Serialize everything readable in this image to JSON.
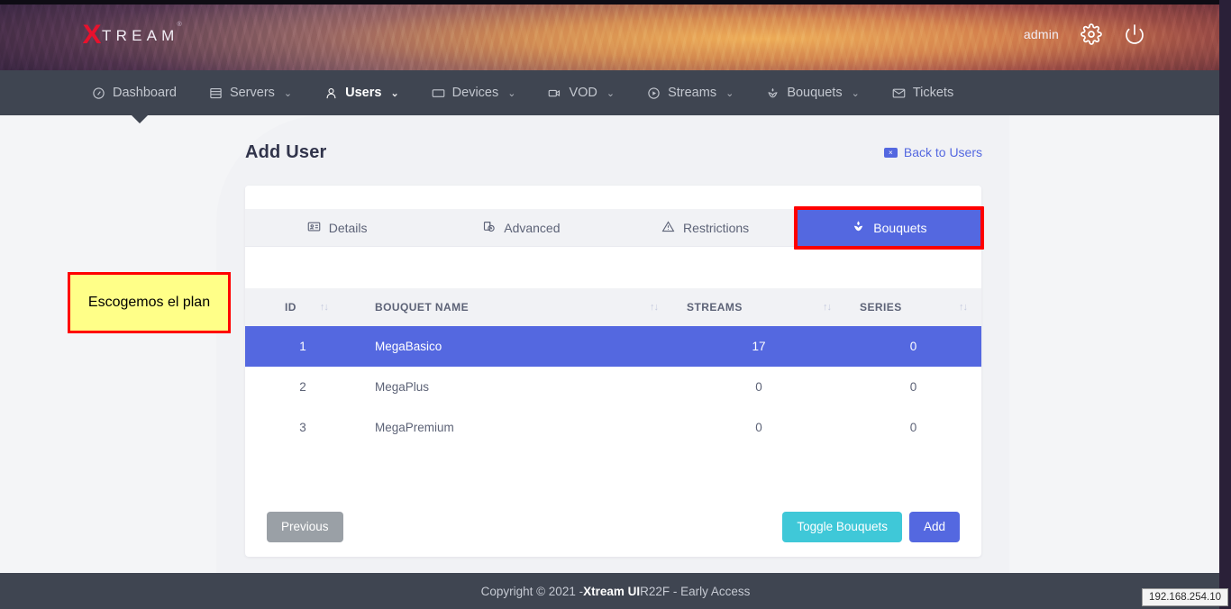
{
  "topbar": {
    "brand_x": "X",
    "brand_rest": "TREAM",
    "brand_tm": "®",
    "admin_label": "admin",
    "settings_icon": "gear-icon",
    "power_icon": "power-icon"
  },
  "nav": {
    "items": [
      {
        "label": "Dashboard",
        "icon": "dashboard-icon",
        "caret": "",
        "active": false
      },
      {
        "label": "Servers",
        "icon": "server-icon",
        "caret": "⌄",
        "active": false
      },
      {
        "label": "Users",
        "icon": "user-icon",
        "caret": "⌄",
        "active": true
      },
      {
        "label": "Devices",
        "icon": "device-icon",
        "caret": "⌄",
        "active": false
      },
      {
        "label": "VOD",
        "icon": "video-icon",
        "caret": "⌄",
        "active": false
      },
      {
        "label": "Streams",
        "icon": "play-icon",
        "caret": "⌄",
        "active": false
      },
      {
        "label": "Bouquets",
        "icon": "bouquet-icon",
        "caret": "⌄",
        "active": false
      },
      {
        "label": "Tickets",
        "icon": "envelope-icon",
        "caret": "",
        "active": false
      }
    ]
  },
  "page": {
    "title": "Add User",
    "back_link": "Back to Users",
    "back_badge": "×"
  },
  "tabs": [
    {
      "label": "Details",
      "icon": "id-card-icon",
      "active": false
    },
    {
      "label": "Advanced",
      "icon": "clock-copy-icon",
      "active": false
    },
    {
      "label": "Restrictions",
      "icon": "warning-icon",
      "active": false
    },
    {
      "label": "Bouquets",
      "icon": "bouquet-icon",
      "active": true
    }
  ],
  "table": {
    "columns": [
      "ID",
      "BOUQUET NAME",
      "STREAMS",
      "SERIES"
    ],
    "sort_glyph": "↑↓",
    "rows": [
      {
        "id": "1",
        "name": "MegaBasico",
        "streams": "17",
        "series": "0",
        "selected": true
      },
      {
        "id": "2",
        "name": "MegaPlus",
        "streams": "0",
        "series": "0",
        "selected": false
      },
      {
        "id": "3",
        "name": "MegaPremium",
        "streams": "0",
        "series": "0",
        "selected": false
      }
    ]
  },
  "buttons": {
    "previous": "Previous",
    "toggle_bouquets": "Toggle Bouquets",
    "add": "Add"
  },
  "annotation": {
    "text": "Escogemos el plan"
  },
  "footer": {
    "prefix": "Copyright © 2021 - ",
    "brand": "Xtream UI",
    "suffix": " R22F - Early Access"
  },
  "ip_badge": "192.168.254.10",
  "colors": {
    "accent_blue": "#5468e0",
    "teal": "#3fc8d8",
    "grey_button": "#9aa0a6",
    "navbar": "#3f4551",
    "page_bg": "#f4f5f7",
    "annotation_bg": "#ffff88",
    "annotation_border": "#ff0000",
    "brand_red": "#e8112d"
  }
}
